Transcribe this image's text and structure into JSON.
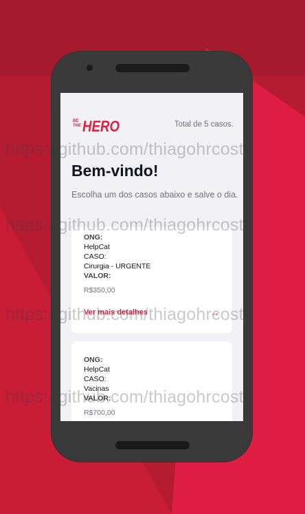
{
  "header": {
    "logo_text": "BE THE HERO",
    "total_cases": "Total de 5 casos."
  },
  "main": {
    "title": "Bem-vindo!",
    "subtitle": "Escolha um dos casos abaixo e salve o dia."
  },
  "cases": [
    {
      "ong_label": "ONG:",
      "ong": "HelpCat",
      "case_label": "CASO:",
      "case": "Cirurgia - URGENTE",
      "value_label": "VALOR:",
      "value": "R$350,00",
      "details_label": "Ver mais detalhes",
      "details_icon": "arrow-right-icon"
    },
    {
      "ong_label": "ONG:",
      "ong": "HelpCat",
      "case_label": "CASO:",
      "case": "Vacinas",
      "value_label": "VALOR:",
      "value": "R$700,00"
    }
  ],
  "watermark": "https://github.com/thiagohrcosta",
  "colors": {
    "accent": "#e02041",
    "background": "#b51c32",
    "phone": "#3a3a3a",
    "screen": "#f0f0f5"
  }
}
